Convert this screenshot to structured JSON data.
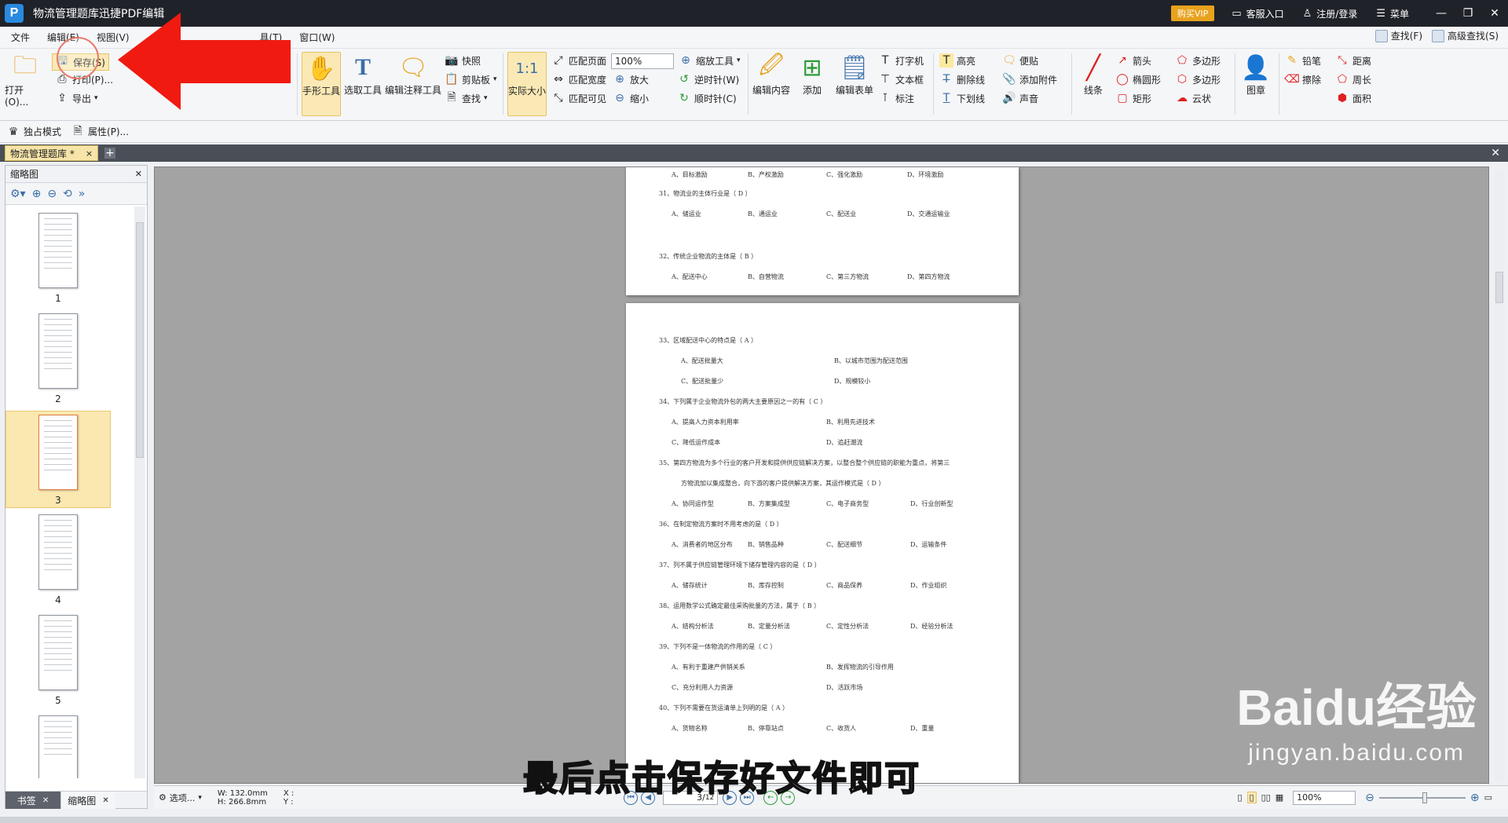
{
  "window": {
    "title": "物流管理题库迅捷PDF编辑",
    "logo": "P",
    "vip": "购买VIP",
    "service": "客服入口",
    "login": "注册/登录",
    "menu": "菜单"
  },
  "menubar": {
    "items": [
      "文件",
      "编辑(E)",
      "视图(V)",
      "具(T)",
      "窗口(W)"
    ],
    "find": "查找(F)",
    "advanced_find": "高级查找(S)"
  },
  "ribbon": {
    "open": "打开(O)...",
    "save": "保存(S)",
    "print": "打印(P)...",
    "export": "导出",
    "hand_tool": "手形工具",
    "select_tool": "选取工具",
    "edit_annot": "编辑注释工具",
    "snapshot": "快照",
    "clipboard": "剪贴板",
    "find": "查找",
    "actual_size": "实际大小",
    "fit_page": "匹配页面",
    "fit_width": "匹配宽度",
    "fit_visible": "匹配可见",
    "zoom_value": "100%",
    "zoom_tool": "缩放工具",
    "zoom_in": "放大",
    "zoom_out": "缩小",
    "rotate_ccw": "逆时针(W)",
    "rotate_cw": "顺时针(C)",
    "edit_content": "编辑内容",
    "add": "添加",
    "edit_form": "编辑表单",
    "typewriter": "打字机",
    "textbox": "文本框",
    "callout": "标注",
    "highlight": "高亮",
    "strikeout": "删除线",
    "underline": "下划线",
    "note": "便贴",
    "attach": "添加附件",
    "sound": "声音",
    "line": "线条",
    "arrow": "箭头",
    "ellipse": "椭圆形",
    "rect": "矩形",
    "polygon": "多边形",
    "polyline": "多边形",
    "cloud": "云状",
    "stamp": "图章",
    "pencil": "铅笔",
    "eraser": "擦除",
    "distance": "距离",
    "perimeter": "周长",
    "area": "面积",
    "exclusive": "独占模式",
    "properties": "属性(P)..."
  },
  "tab": {
    "name": "物流管理题库 *",
    "close": "×",
    "add": "+"
  },
  "sidebar": {
    "title": "缩略图",
    "thumbnails": [
      "1",
      "2",
      "3",
      "4",
      "5"
    ],
    "tab_bookmark": "书签",
    "tab_thumbnail": "缩略图"
  },
  "page_top": {
    "opts": [
      "A、目标激励",
      "B、产权激励",
      "C、强化激励",
      "D、环境激励"
    ],
    "q31": "31、物流业的主体行业是（ D ）",
    "q31_opts": [
      "A、储运业",
      "B、通运业",
      "C、配送业",
      "D、交通运输业"
    ],
    "q32": "32、传统企业物流的主体是（ B ）",
    "q32_opts": [
      "A、配送中心",
      "B、自营物流",
      "C、第三方物流",
      "D、第四方物流"
    ]
  },
  "page_main": {
    "q33": "33、区域配送中心的特点是（ A ）",
    "q33_a": "A、配送批量大",
    "q33_b": "B、以城市范围为配送范围",
    "q33_c": "C、配送批量少",
    "q33_d": "D、规模较小",
    "q34": "34、下列属于企业物流外包的两大主要原因之一的有（ C ）",
    "q34_a": "A、提高人力资本利用率",
    "q34_b": "B、利用先进技术",
    "q34_c": "C、降低运作成本",
    "q34_d": "D、追赶潮流",
    "q35": "35、第四方物流为多个行业的客户开发和提供供应链解决方案，以整合整个供应链的职能为重点，将第三",
    "q35b": "方物流加以集成整合，向下游的客户提供解决方案，其运作模式是（ D ）",
    "q35_opts": [
      "A、协同运作型",
      "B、方案集成型",
      "C、电子商务型",
      "D、行业创新型"
    ],
    "q36": "36、在制定物流方案时不用考虑的是（ D ）",
    "q36_opts": [
      "A、消费者的地区分布",
      "B、销售品种",
      "C、配送细节",
      "D、运输条件"
    ],
    "q37": "37、列不属于供应链管理环境下储存管理内容的是（ D ）",
    "q37_opts": [
      "A、储存统计",
      "B、库存控制",
      "C、商品保养",
      "D、作业组织"
    ],
    "q38": "38、运用数学公式确定最佳采购批量的方法，属于（ B ）",
    "q38_opts": [
      "A、结构分析法",
      "B、定量分析法",
      "C、定性分析法",
      "D、经验分析法"
    ],
    "q39": "39、下列不是一体物流的作用的是（ C ）",
    "q39_a": "A、有利于重建产供销关系",
    "q39_b": "B、发挥物流的引导作用",
    "q39_c": "C、充分利用人力资源",
    "q39_d": "D、活跃市场",
    "q40": "40、下列不需要在货运清单上列明的是（ A ）",
    "q40_opts": [
      "A、货物名称",
      "B、停靠站点",
      "C、收货人",
      "D、重量"
    ]
  },
  "statusbar": {
    "options": "选项...",
    "width": "W: 132.0mm",
    "height": "H: 266.8mm",
    "x": "X :",
    "y": "Y :",
    "page": "3",
    "page_total": "12",
    "zoom": "100%"
  },
  "overlay": {
    "subtitle": "最后点击保存好文件即可",
    "watermark_1": "Baidu经验",
    "watermark_2": "jingyan.baidu.com"
  },
  "colors": {
    "arrow": "#f01a10",
    "accent": "#2a8ae0",
    "vip": "#e8a21c"
  }
}
